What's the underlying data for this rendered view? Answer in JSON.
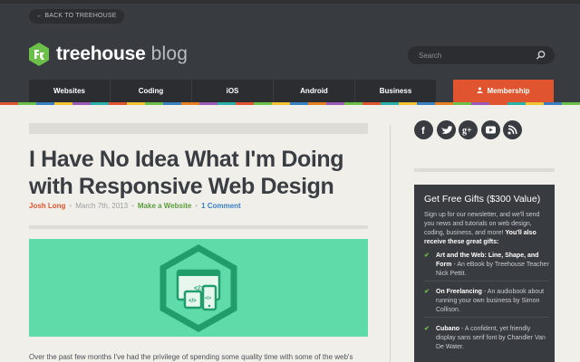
{
  "header": {
    "back_label": "← BACK TO TREEHOUSE",
    "logo_name": "treehouse",
    "logo_suffix": "blog",
    "search_placeholder": "Search"
  },
  "nav": {
    "items": [
      "Websites",
      "Coding",
      "iOS",
      "Android",
      "Business"
    ],
    "membership_label": "Membership"
  },
  "stripe_colors": [
    "#e0552f",
    "#6cc04a",
    "#3a7fc1",
    "#f1c232",
    "#9b59b6",
    "#2ab0a6",
    "#e0552f",
    "#f1c232",
    "#6cc04a",
    "#3a7fc1",
    "#e67e22",
    "#9b59b6",
    "#2ab0a6",
    "#e0552f",
    "#6cc04a",
    "#f1c232",
    "#3a7fc1",
    "#e67e22",
    "#9b59b6",
    "#6cc04a",
    "#e0552f",
    "#2ab0a6",
    "#f1c232",
    "#3a7fc1",
    "#e67e22",
    "#6cc04a",
    "#9b59b6",
    "#e0552f",
    "#2ab0a6",
    "#f1c232",
    "#3a7fc1",
    "#6cc04a"
  ],
  "article": {
    "title": "I Have No Idea What I'm Doing with Responsive Web Design",
    "author": "Josh Long",
    "date": "March 7th, 2013",
    "category": "Make a Website",
    "comments": "1 Comment",
    "excerpt": "Over the past few months I've had the privilege of spending some quality time with some of the web's"
  },
  "sidebar": {
    "social": [
      {
        "icon": "facebook-icon",
        "glyph": "f"
      },
      {
        "icon": "twitter-icon",
        "glyph": ""
      },
      {
        "icon": "googleplus-icon",
        "glyph": "g+"
      },
      {
        "icon": "youtube-icon",
        "glyph": ""
      },
      {
        "icon": "rss-icon",
        "glyph": ""
      }
    ],
    "gifts_title": "Get Free Gifts ($300 Value)",
    "gifts_intro": "Sign up for our newsletter, and we'll send you news and tutorials on web design, coding, business, and more!",
    "gifts_intro_bold": "You'll also receive these great gifts:",
    "gifts": [
      {
        "title": "Art and the Web: Line, Shape, and Form",
        "desc": " - An eBook by Treehouse Teacher Nick Pettit."
      },
      {
        "title": "On Freelancing",
        "desc": " - An audiobook about running your own business by Simon Collison."
      },
      {
        "title": "Cubano",
        "desc": " - A confident, yet friendly display sans serif font by Chandler Van De Water."
      }
    ]
  },
  "colors": {
    "header_bg": "#383b40",
    "accent": "#e0552f",
    "brand_green": "#6cc04a",
    "link_blue": "#3a7fc1",
    "hero_bg": "#5fdaa9"
  }
}
